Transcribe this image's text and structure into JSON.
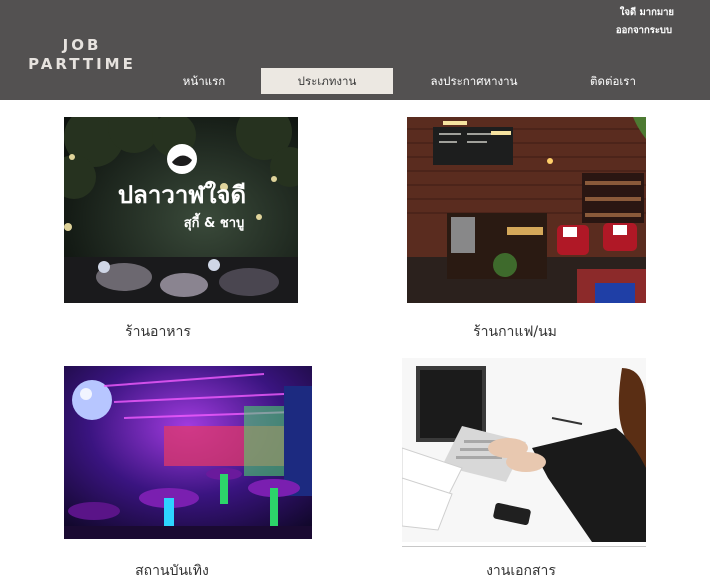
{
  "header": {
    "logo_line1": "JOB",
    "logo_line2": "PARTTIME",
    "user_name": "ใจดี มากมาย",
    "logout_label": "ออกจากระบบ",
    "nav": [
      {
        "label": "หน้าแรก"
      },
      {
        "label": "ประเภทงาน"
      },
      {
        "label": "ลงประกาศหางาน"
      },
      {
        "label": "ติดต่อเรา"
      }
    ]
  },
  "categories": [
    {
      "label": "ร้านอาหาร",
      "sign_title": "ปลาวาฬใจดี",
      "sign_subtitle": "สุกี้ & ชาบู"
    },
    {
      "label": "ร้านกาแฟ/นม"
    },
    {
      "label": "สถานบันเทิง"
    },
    {
      "label": "งานเอกสาร"
    }
  ],
  "colors": {
    "header_bg": "#535151",
    "active_tab_bg": "#ece8e2",
    "page_bg": "#ffffff"
  }
}
